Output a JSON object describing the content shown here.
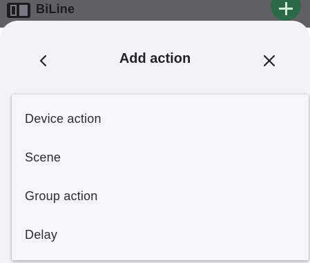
{
  "background_app": {
    "title": "BiLine"
  },
  "sheet": {
    "title": "Add action",
    "back_icon": "chevron-left-icon",
    "close_icon": "close-icon"
  },
  "menu": {
    "items": [
      {
        "label": "Device action"
      },
      {
        "label": "Scene"
      },
      {
        "label": "Group action"
      },
      {
        "label": "Delay"
      }
    ]
  },
  "colors": {
    "sheet_background": "#f1f3f7",
    "menu_background": "#f4f6f9",
    "text": "#2a2d31",
    "fab_green": "#2c6a47"
  }
}
